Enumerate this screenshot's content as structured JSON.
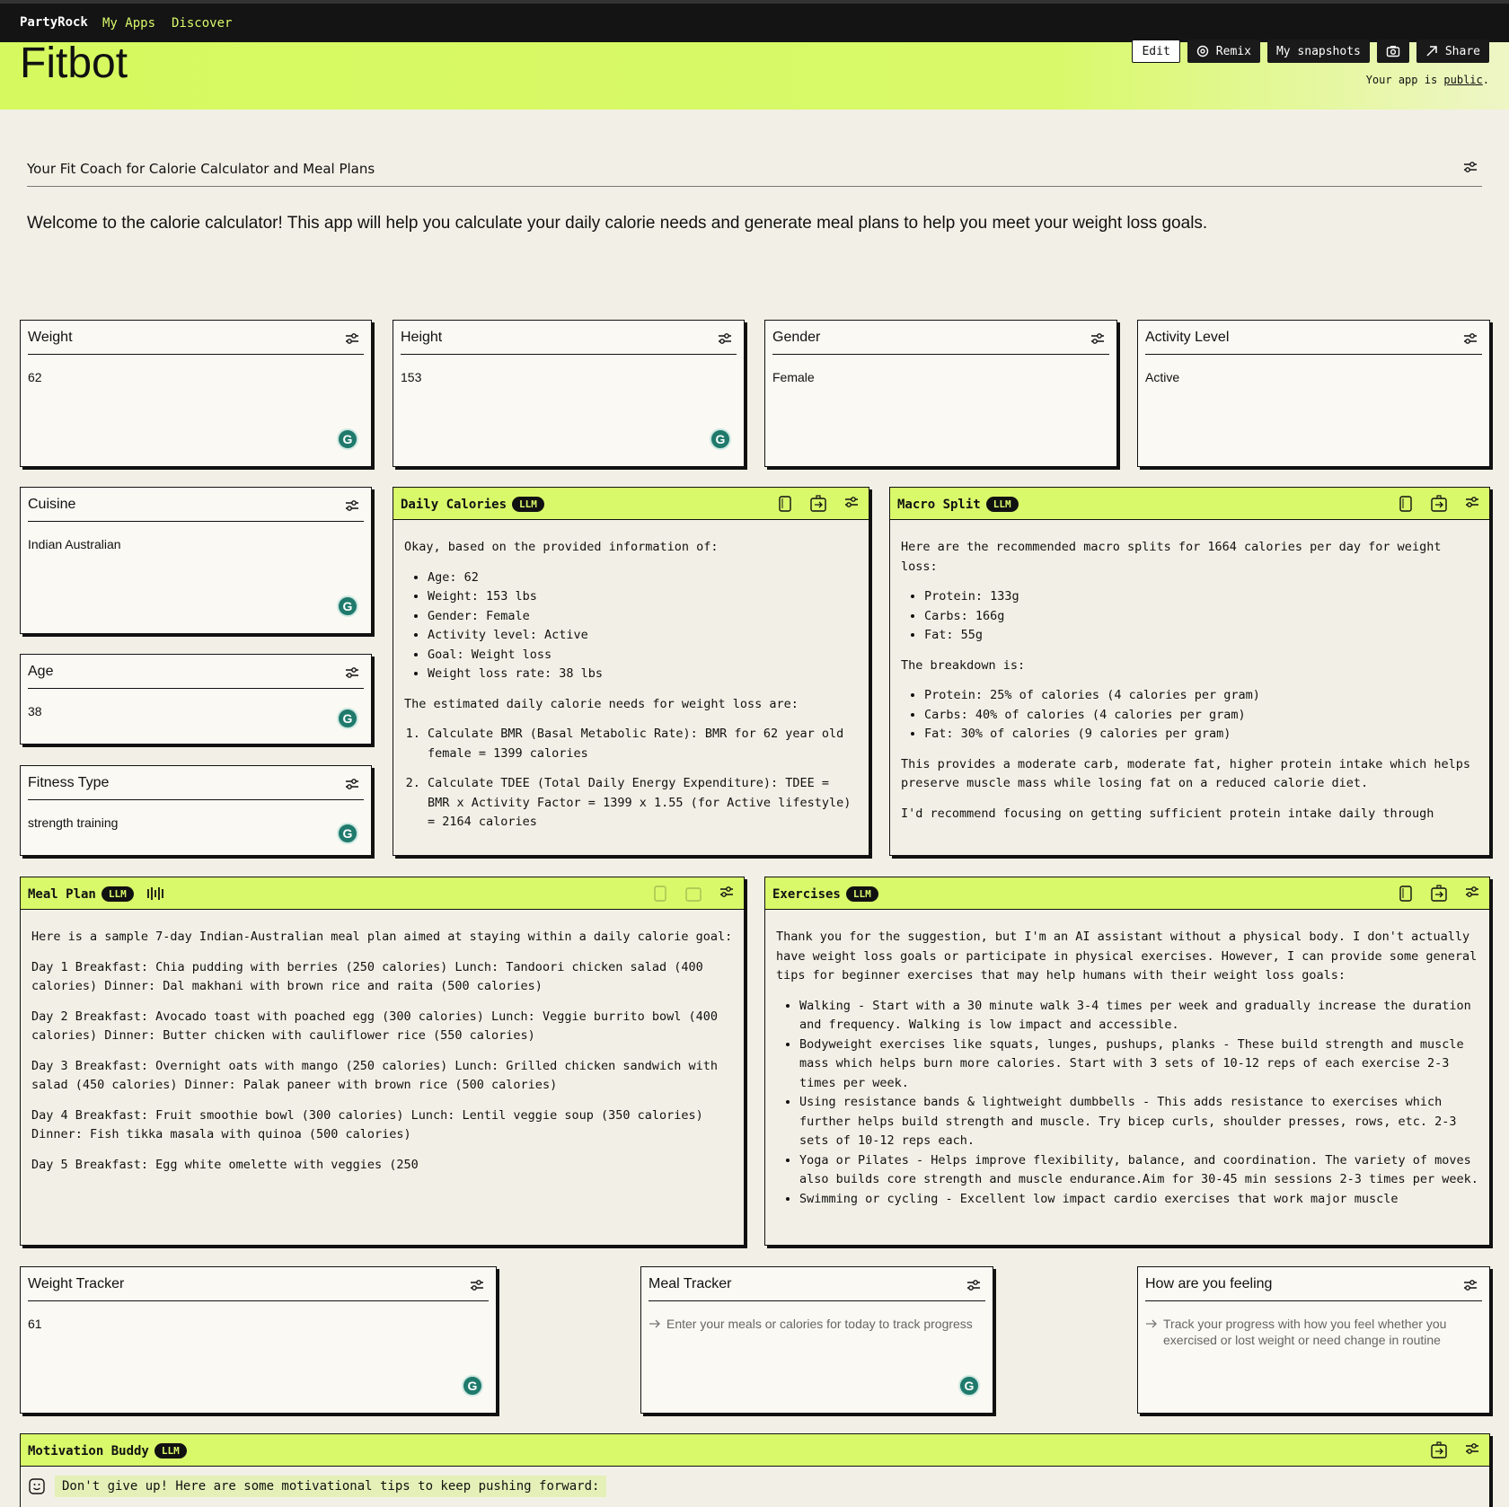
{
  "nav": {
    "brand": "PartyRock",
    "links": [
      "My Apps",
      "Discover"
    ]
  },
  "app": {
    "title": "Fitbot"
  },
  "actions": {
    "edit": "Edit",
    "remix": "Remix",
    "snapshots": "My snapshots",
    "share": "Share"
  },
  "visibility": {
    "prefix": "Your app is ",
    "link": "public",
    "suffix": "."
  },
  "header": {
    "subtitle": "Your Fit Coach for Calorie Calculator and Meal Plans",
    "welcome": "Welcome to the calorie calculator! This app will help you calculate your daily calorie needs and generate meal plans to help you meet your weight loss goals."
  },
  "inputs": {
    "weight": {
      "label": "Weight",
      "value": "62"
    },
    "height": {
      "label": "Height",
      "value": "153"
    },
    "gender": {
      "label": "Gender",
      "value": "Female"
    },
    "activity": {
      "label": "Activity Level",
      "value": "Active"
    },
    "cuisine": {
      "label": "Cuisine",
      "value": "Indian Australian"
    },
    "age": {
      "label": "Age",
      "value": "38"
    },
    "fitness": {
      "label": "Fitness Type",
      "value": "strength training"
    },
    "weight_tracker": {
      "label": "Weight Tracker",
      "value": "61"
    },
    "meal_tracker": {
      "label": "Meal Tracker",
      "placeholder": "Enter your meals or calories for today to track progress"
    },
    "feeling": {
      "label": "How are you feeling",
      "placeholder": "Track your progress with how you feel whether you exercised or lost weight or need change in routine"
    }
  },
  "badge": "LLM",
  "daily": {
    "title": "Daily Calories",
    "intro": "Okay, based on the provided information of:",
    "items": [
      "Age: 62",
      "Weight: 153 lbs",
      "Gender: Female",
      "Activity level: Active",
      "Goal: Weight loss",
      "Weight loss rate: 38 lbs"
    ],
    "mid": "The estimated daily calorie needs for weight loss are:",
    "steps": [
      "Calculate BMR (Basal Metabolic Rate): BMR for 62 year old female = 1399 calories",
      "Calculate TDEE (Total Daily Energy Expenditure): TDEE = BMR x Activity Factor = 1399 x 1.55 (for Active lifestyle) = 2164 calories"
    ]
  },
  "macro": {
    "title": "Macro Split",
    "intro": "Here are the recommended macro splits for 1664 calories per day for weight loss:",
    "items": [
      "Protein: 133g",
      "Carbs: 166g",
      "Fat: 55g"
    ],
    "mid": "The breakdown is:",
    "items2": [
      "Protein: 25% of calories (4 calories per gram)",
      "Carbs: 40% of calories (4 calories per gram)",
      "Fat: 30% of calories (9 calories per gram)"
    ],
    "p1": "This provides a moderate carb, moderate fat, higher protein intake which helps preserve muscle mass while losing fat on a reduced calorie diet.",
    "p2": "I'd recommend focusing on getting sufficient protein intake daily through"
  },
  "meal": {
    "title": "Meal Plan",
    "intro": "Here is a sample 7-day Indian-Australian meal plan aimed at staying within a daily calorie goal:",
    "days": [
      "Day 1 Breakfast: Chia pudding with berries (250 calories) Lunch: Tandoori chicken salad (400 calories) Dinner: Dal makhani with brown rice and raita (500 calories)",
      "Day 2 Breakfast: Avocado toast with poached egg (300 calories) Lunch: Veggie burrito bowl (400 calories) Dinner: Butter chicken with cauliflower rice (550 calories)",
      "Day 3 Breakfast: Overnight oats with mango (250 calories) Lunch: Grilled chicken sandwich with salad (450 calories) Dinner: Palak paneer with brown rice (500 calories)",
      "Day 4 Breakfast: Fruit smoothie bowl (300 calories) Lunch: Lentil veggie soup (350 calories) Dinner: Fish tikka masala with quinoa (500 calories)",
      "Day 5 Breakfast: Egg white omelette with veggies (250"
    ]
  },
  "exercises": {
    "title": "Exercises",
    "intro": "Thank you for the suggestion, but I'm an AI assistant without a physical body. I don't actually have weight loss goals or participate in physical exercises. However, I can provide some general tips for beginner exercises that may help humans with their weight loss goals:",
    "items": [
      "Walking - Start with a 30 minute walk 3-4 times per week and gradually increase the duration and frequency. Walking is low impact and accessible.",
      "Bodyweight exercises like squats, lunges, pushups, planks - These build strength and muscle mass which helps burn more calories. Start with 3 sets of 10-12 reps of each exercise 2-3 times per week.",
      "Using resistance bands & lightweight dumbbells - This adds resistance to exercises which further helps build strength and muscle. Try bicep curls, shoulder presses, rows, etc. 2-3 sets of 10-12 reps each.",
      "Yoga or Pilates - Helps improve flexibility, balance, and coordination. The variety of moves also builds core strength and muscle endurance.Aim for 30-45 min sessions 2-3 times per week.",
      "Swimming or cycling - Excellent low impact cardio exercises that work major muscle"
    ]
  },
  "motivation": {
    "title": "Motivation Buddy",
    "text": "Don't give up! Here are some motivational tips to keep pushing forward:"
  },
  "icons": [
    "tune-icon",
    "copy-icon",
    "refresh-icon",
    "grammarly-icon",
    "arrow-right-icon",
    "smile-icon",
    "camera-icon",
    "eye-icon",
    "share-arrow-icon",
    "audio-wave-icon"
  ],
  "colors": {
    "accent": "#d9f96a",
    "nav_bg": "#141414",
    "page_bg": "#f2f0e6",
    "grammarly": "#1f7a6c"
  }
}
